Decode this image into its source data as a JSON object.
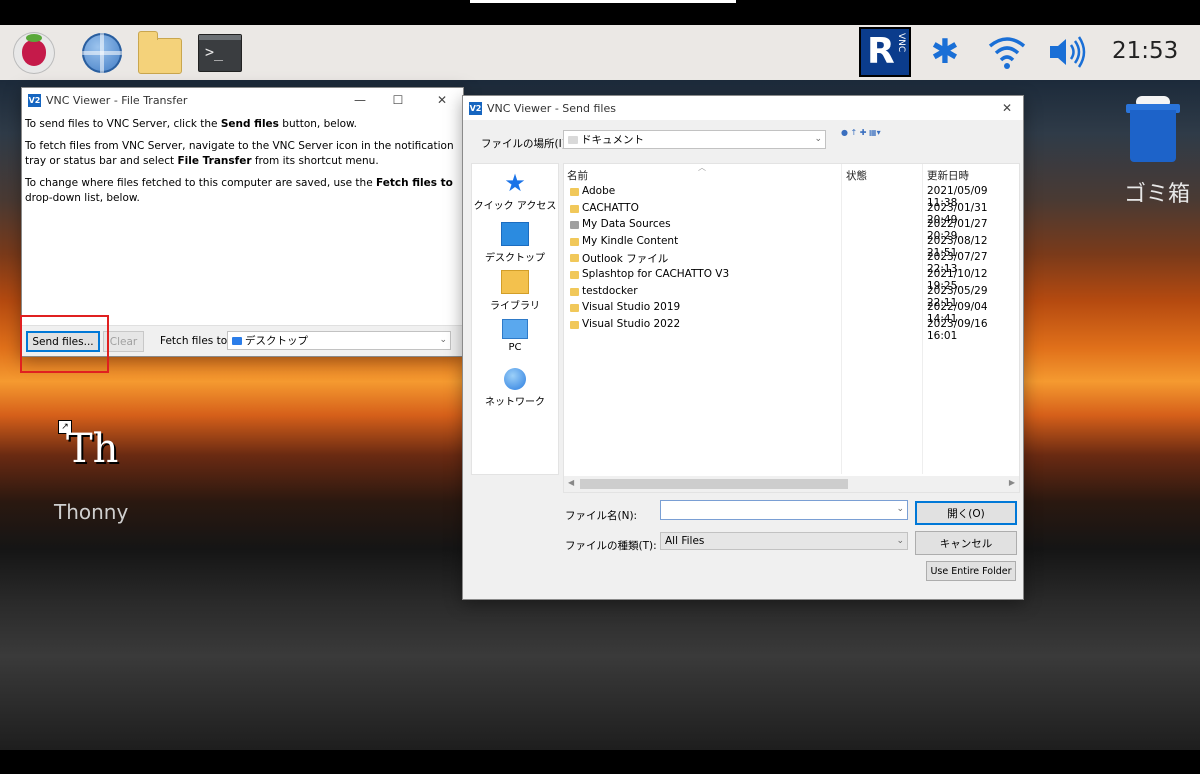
{
  "taskbar": {
    "clock": "21:53",
    "terminal_glyph": ">_",
    "vnc_letter": "R",
    "vnc_small": "VNC",
    "bluetooth_glyph": "✱",
    "icons": [
      "raspberry-pi-menu-icon",
      "web-browser-globe-icon",
      "file-manager-folder-icon",
      "terminal-icon",
      "vnc-server-icon",
      "bluetooth-icon",
      "wifi-icon",
      "volume-icon"
    ]
  },
  "desktop": {
    "trash_label": "ゴミ箱",
    "thonny_glyph": "Th",
    "thonny_label": "Thonny"
  },
  "file_transfer": {
    "logo": "V2",
    "title": "VNC Viewer - File Transfer",
    "p1_a": "To send files to VNC Server, click the ",
    "p1_b": "Send files",
    "p1_c": " button, below.",
    "p2_a": "To fetch files from VNC Server, navigate to the VNC Server icon in the notification tray or status bar and select ",
    "p2_b": "File Transfer",
    "p2_c": " from its shortcut menu.",
    "p3_a": "To change where files fetched to this computer are saved, use the ",
    "p3_b": "Fetch files to",
    "p3_c": " drop-down list, below.",
    "send_button": "Send files...",
    "clear_button": "Clear",
    "fetch_label": "Fetch files to:",
    "fetch_value": "デスクトップ"
  },
  "send_files": {
    "logo": "V2",
    "title": "VNC Viewer - Send files",
    "location_label": "ファイルの場所(I):",
    "location_value": "ドキュメント",
    "nav": [
      {
        "label": "クイック アクセス"
      },
      {
        "label": "デスクトップ"
      },
      {
        "label": "ライブラリ"
      },
      {
        "label": "PC"
      },
      {
        "label": "ネットワーク"
      }
    ],
    "columns": {
      "name": "名前",
      "status": "状態",
      "modified": "更新日時"
    },
    "files": [
      {
        "name": "Adobe",
        "date": "2021/05/09 11:38"
      },
      {
        "name": "CACHATTO",
        "date": "2023/01/31 20:49"
      },
      {
        "name": "My Data Sources",
        "date": "2022/01/27 20:29"
      },
      {
        "name": "My Kindle Content",
        "date": "2023/08/12 21:51"
      },
      {
        "name": "Outlook ファイル",
        "date": "2023/07/27 22:13"
      },
      {
        "name": "Splashtop for CACHATTO V3",
        "date": "2021/10/12 19:25"
      },
      {
        "name": "testdocker",
        "date": "2023/05/29 22:11"
      },
      {
        "name": "Visual Studio 2019",
        "date": "2022/09/04 14:41"
      },
      {
        "name": "Visual Studio 2022",
        "date": "2023/09/16 16:01"
      }
    ],
    "filename_label": "ファイル名(N):",
    "filename_value": "",
    "filetype_label": "ファイルの種類(T):",
    "filetype_value": "All Files",
    "open_button": "開く(O)",
    "cancel_button": "キャンセル",
    "entire_folder_button": "Use Entire Folder"
  }
}
